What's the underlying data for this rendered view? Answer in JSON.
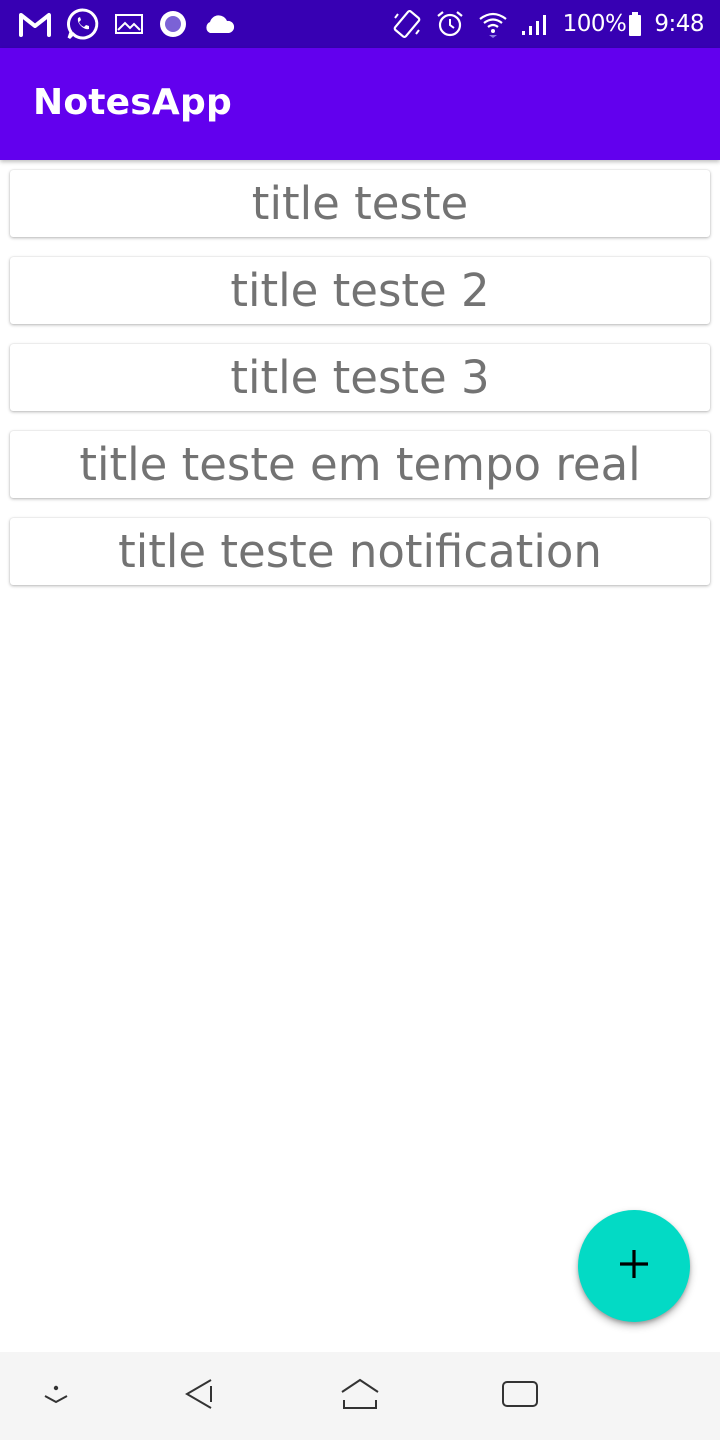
{
  "status_bar": {
    "battery": "100%",
    "time": "9:48",
    "left_icons": [
      "gmail-icon",
      "whatsapp-icon",
      "gallery-icon",
      "circle-app-icon",
      "cloud-icon"
    ],
    "right_icons": [
      "auto-rotate-icon",
      "alarm-icon",
      "wifi-icon",
      "signal-icon",
      "battery-icon"
    ]
  },
  "app_bar": {
    "title": "NotesApp",
    "color": "#6200ee"
  },
  "notes": [
    {
      "title": "title teste"
    },
    {
      "title": "title teste 2"
    },
    {
      "title": "title teste 3"
    },
    {
      "title": "title teste em tempo real"
    },
    {
      "title": "title teste notification"
    }
  ],
  "fab": {
    "icon": "plus-icon",
    "color": "#03dac5"
  },
  "nav_bar": {
    "buttons": [
      "hide-nav-icon",
      "back-icon",
      "home-icon",
      "recents-icon"
    ]
  }
}
